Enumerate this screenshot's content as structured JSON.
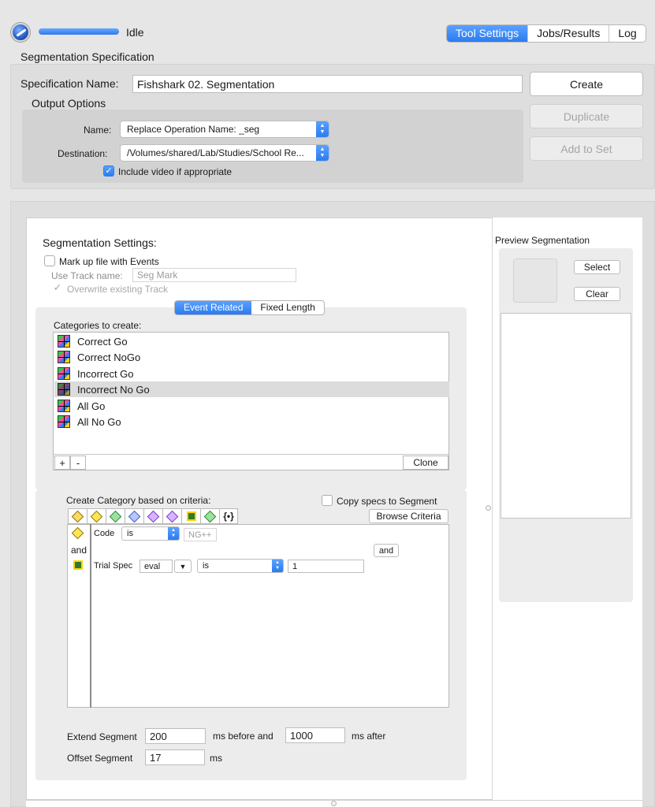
{
  "status": {
    "label": "Idle",
    "progress": 1.0
  },
  "tabs": [
    {
      "label": "Tool Settings",
      "active": true
    },
    {
      "label": "Jobs/Results",
      "active": false
    },
    {
      "label": "Log",
      "active": false
    }
  ],
  "spec": {
    "section_title": "Segmentation Specification",
    "name_label": "Specification Name:",
    "name_value": "Fishshark 02. Segmentation",
    "output_title": "Output Options",
    "output_name_label": "Name:",
    "output_name_value": "Replace Operation Name: _seg",
    "destination_label": "Destination:",
    "destination_value": "/Volumes/shared/Lab/Studies/School Re...",
    "include_video_label": "Include video if appropriate",
    "include_video_checked": true
  },
  "actions": {
    "create": "Create",
    "duplicate": "Duplicate",
    "add_to_set": "Add to Set"
  },
  "seg_settings": {
    "title": "Segmentation Settings:",
    "markup_label": "Mark up file with Events",
    "track_label": "Use Track name:",
    "track_value": "Seg Mark",
    "overwrite_label": "Overwrite existing Track",
    "mode_tabs": [
      {
        "label": "Event Related",
        "active": true
      },
      {
        "label": "Fixed Length",
        "active": false
      }
    ]
  },
  "categories": {
    "label": "Categories to create:",
    "items": [
      {
        "label": "Correct Go",
        "selected": false
      },
      {
        "label": "Correct NoGo",
        "selected": false
      },
      {
        "label": "Incorrect Go",
        "selected": false
      },
      {
        "label": "Incorrect No Go",
        "selected": true
      },
      {
        "label": "All Go",
        "selected": false
      },
      {
        "label": "All No Go",
        "selected": false
      }
    ],
    "add": "+",
    "remove": "-",
    "clone": "Clone"
  },
  "criteria": {
    "title": "Create Category based on criteria:",
    "copy_specs_label": "Copy specs to Segment",
    "browse": "Browse Criteria",
    "toolbar_icons": [
      "filter-icon",
      "event-code-icon",
      "time-icon",
      "cell-icon",
      "spec-icon",
      "key-icon",
      "chip-icon",
      "signal-icon",
      "bracket-icon"
    ],
    "and_gutter": "and",
    "row1": {
      "field": "Code",
      "operator": "is",
      "value_placeholder": "NG++"
    },
    "row2": {
      "field": "Trial Spec",
      "spec_field": "eval",
      "operator": "is",
      "value": "1"
    },
    "and_button": "and"
  },
  "extend": {
    "label": "Extend Segment",
    "before_value": "200",
    "before_label": "ms before and",
    "after_value": "1000",
    "after_label": "ms after"
  },
  "offset": {
    "label": "Offset Segment",
    "value": "17",
    "unit": "ms"
  },
  "preview": {
    "title": "Preview Segmentation",
    "select": "Select",
    "clear": "Clear"
  }
}
